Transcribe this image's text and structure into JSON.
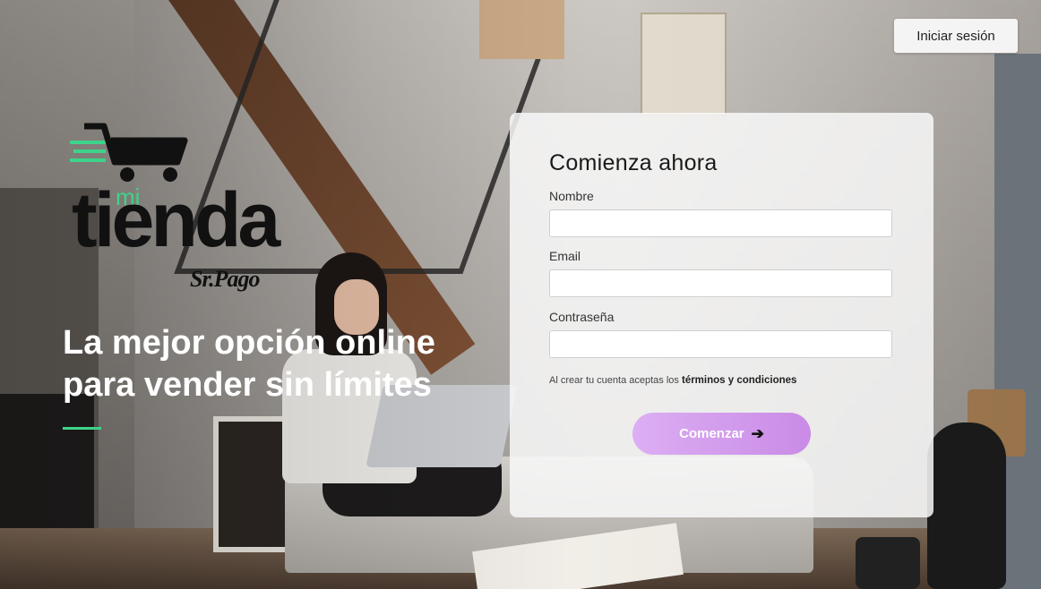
{
  "header": {
    "login_label": "Iniciar sesión"
  },
  "brand": {
    "mi": "mi",
    "tienda": "tienda",
    "partner": "Sr.Pago"
  },
  "hero": {
    "tagline_line1": "La mejor opción online",
    "tagline_line2": "para vender sin límites"
  },
  "form": {
    "title": "Comienza ahora",
    "name_label": "Nombre",
    "name_value": "",
    "email_label": "Email",
    "email_value": "",
    "password_label": "Contraseña",
    "password_value": "",
    "terms_prefix": "Al crear tu cuenta aceptas los",
    "terms_link": "términos y condiciones",
    "submit_label": "Comenzar",
    "submit_icon": "arrow-right-icon"
  },
  "colors": {
    "accent_green": "#3ed38a",
    "button_purple": "#cf95ea",
    "card_bg": "#f8f8f8"
  }
}
